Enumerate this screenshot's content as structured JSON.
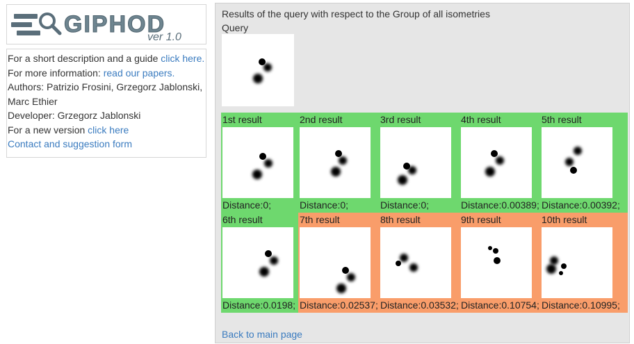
{
  "logo": {
    "title": "GIPHOD",
    "version": "ver 1.0"
  },
  "info": {
    "line1_text": "For a short description and a guide ",
    "line1_link": "click here.",
    "line2_text": "For more information: ",
    "line2_link": "read our papers.",
    "authors": "Authors: Patrizio Frosini, Grzegorz Jablonski, Marc Ethier",
    "developer": "Developer: Grzegorz Jablonski",
    "line5_text": "For a new version ",
    "line5_link": "click here",
    "contact_link": "Contact and suggestion form"
  },
  "main": {
    "header": "Results of the query with respect to the Group of all isometries",
    "query_label": "Query",
    "back_link": "Back to main page"
  },
  "colors": {
    "match": "#6ed86e",
    "nonmatch": "#f99d6a"
  },
  "results": [
    {
      "label": "1st result",
      "distance": "Distance:0;",
      "match": true
    },
    {
      "label": "2nd result",
      "distance": "Distance:0;",
      "match": true
    },
    {
      "label": "3rd result",
      "distance": "Distance:0;",
      "match": true
    },
    {
      "label": "4th result",
      "distance": "Distance:0.00389;",
      "match": true
    },
    {
      "label": "5th result",
      "distance": "Distance:0.00392;",
      "match": true
    },
    {
      "label": "6th result",
      "distance": "Distance:0.0198;",
      "match": true
    },
    {
      "label": "7th result",
      "distance": "Distance:0.02537;",
      "match": false
    },
    {
      "label": "8th result",
      "distance": "Distance:0.03532;",
      "match": false
    },
    {
      "label": "9th result",
      "distance": "Distance:0.10754;",
      "match": false
    },
    {
      "label": "10th result",
      "distance": "Distance:0.10995;",
      "match": false
    }
  ]
}
